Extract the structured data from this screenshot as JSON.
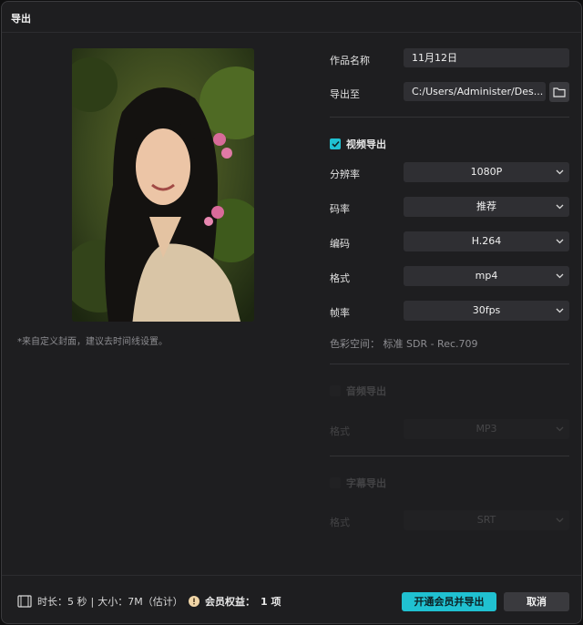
{
  "dialog": {
    "title": "导出"
  },
  "cover": {
    "note": "*来自定义封面，建议去时间线设置。"
  },
  "form": {
    "name_label": "作品名称",
    "name_value": "11月12日",
    "path_label": "导出至",
    "path_value": "C:/Users/Administer/Des..."
  },
  "video": {
    "section_label": "视频导出",
    "checked": true,
    "rows": [
      {
        "label": "分辨率",
        "value": "1080P"
      },
      {
        "label": "码率",
        "value": "推荐"
      },
      {
        "label": "编码",
        "value": "H.264"
      },
      {
        "label": "格式",
        "value": "mp4"
      },
      {
        "label": "帧率",
        "value": "30fps"
      }
    ],
    "color_space": "色彩空间： 标准 SDR - Rec.709"
  },
  "audio": {
    "section_label": "音频导出",
    "checked": false,
    "format_label": "格式",
    "format_value": "MP3"
  },
  "subtitle": {
    "section_label": "字幕导出",
    "checked": false,
    "format_label": "格式",
    "format_value": "SRT"
  },
  "footer": {
    "duration_label": "时长：",
    "duration_value": "5 秒",
    "size_label": "大小：",
    "size_value": "7M（估计）",
    "member_label": "会员权益：",
    "member_value": "1 项",
    "primary_button": "开通会员并导出",
    "cancel_button": "取消"
  },
  "colors": {
    "accent": "#20c1d1",
    "panel": "#1e1e20",
    "field": "#2f2f33"
  }
}
